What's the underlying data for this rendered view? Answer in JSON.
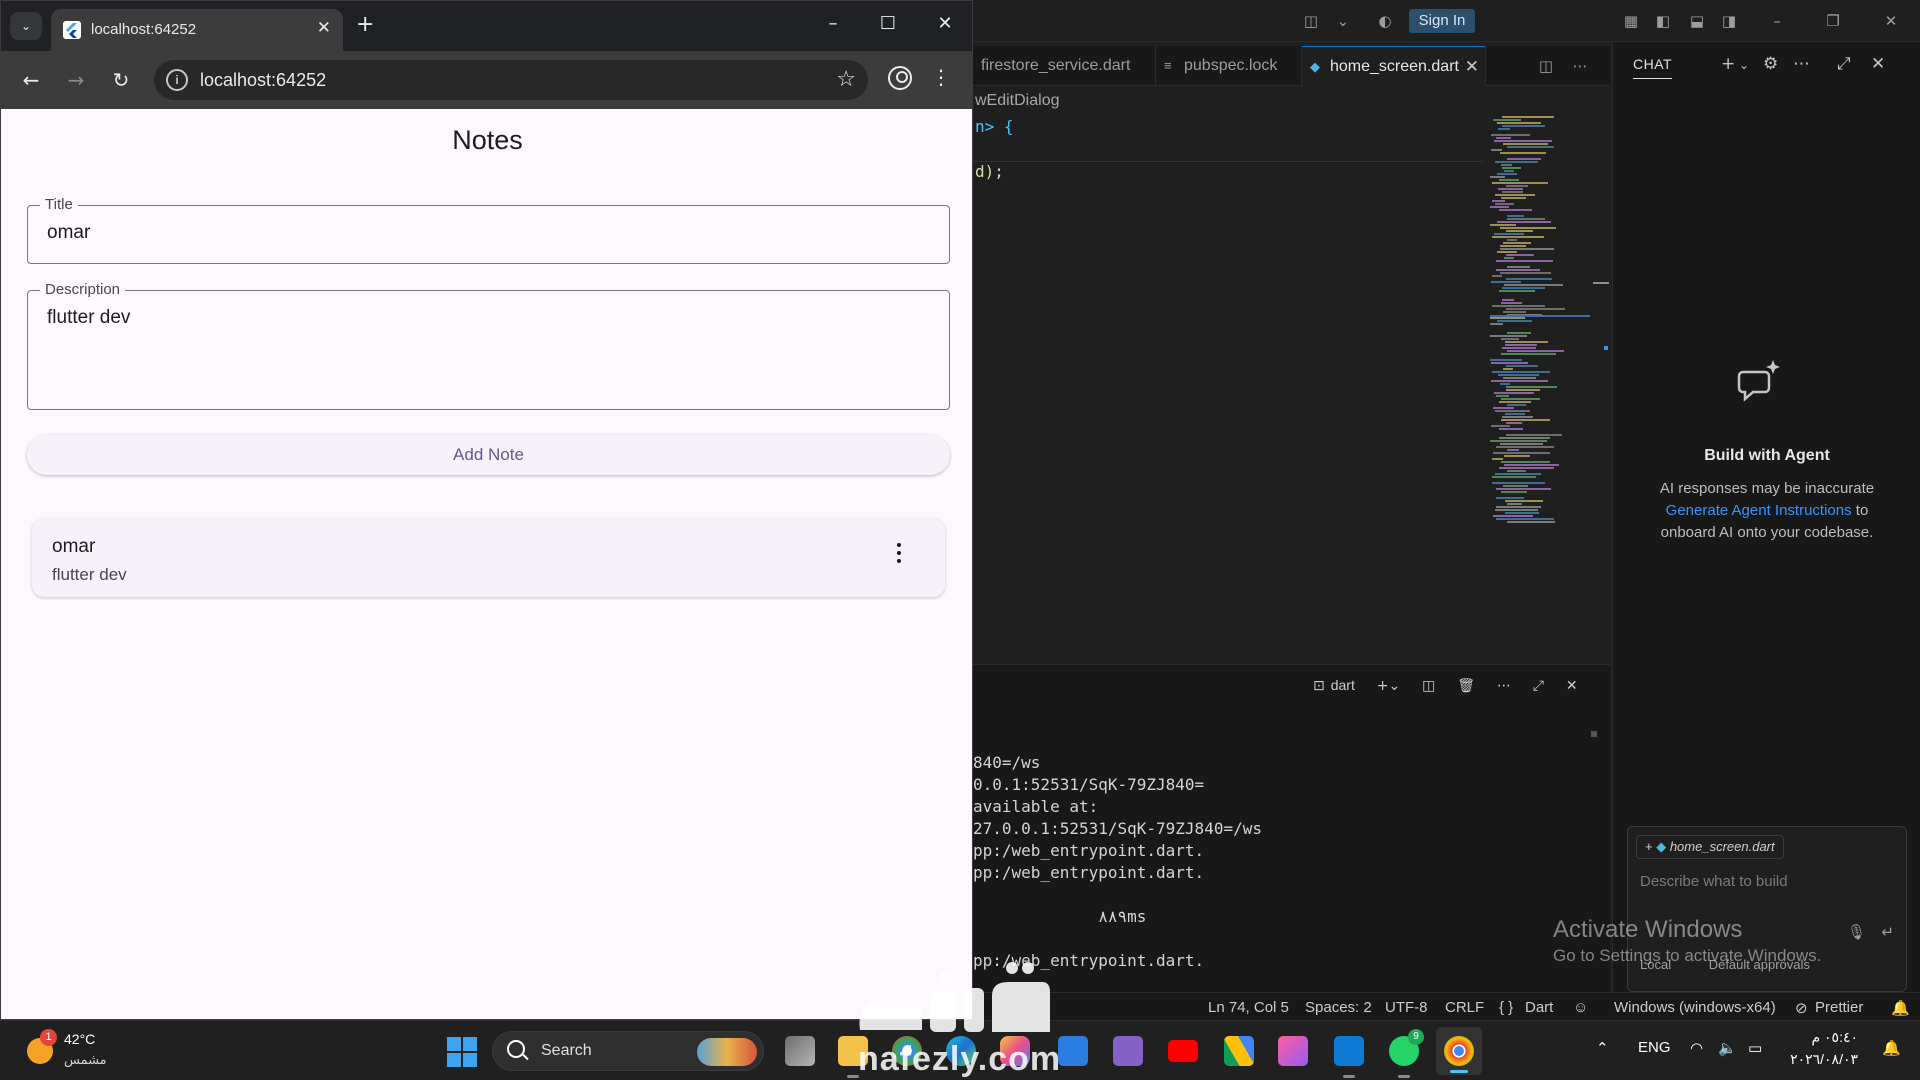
{
  "chrome": {
    "tab_title": "localhost:64252",
    "tab_close": "✕",
    "new_tab": "+",
    "url": "localhost:64252",
    "minimize": "–",
    "maximize": "☐",
    "close": "✕"
  },
  "app": {
    "title": "Notes",
    "title_field": {
      "label": "Title",
      "value": "omar"
    },
    "description_field": {
      "label": "Description",
      "value": "flutter dev"
    },
    "add_button": "Add Note",
    "notes": [
      {
        "title": "omar",
        "description": "flutter dev"
      }
    ]
  },
  "vscode": {
    "sign_in": "Sign In",
    "tabs": [
      {
        "label": "firestore_service.dart",
        "active": false
      },
      {
        "label": "pubspec.lock",
        "active": false
      },
      {
        "label": "home_screen.dart",
        "active": true
      }
    ],
    "breadcrumb": "wEditDialog",
    "code_lines": [
      "n> {",
      "d);"
    ],
    "chat": {
      "header": "CHAT",
      "agent_title": "Build with Agent",
      "agent_desc_1": "AI responses may be inaccurate",
      "agent_link": "Generate Agent Instructions",
      "agent_desc_2": " to onboard AI onto your codebase.",
      "context_file": "home_screen.dart",
      "input_placeholder": "Describe what to build",
      "mode_local": "Local",
      "mode_approvals": "Default approvals"
    },
    "terminal": {
      "profile": "dart",
      "lines": [
        "840=/ws",
        "0.0.1:52531/SqK-79ZJ840=",
        "available at:",
        "27.0.0.1:52531/SqK-79ZJ840=/ws",
        "pp:/web_entrypoint.dart.",
        "pp:/web_entrypoint.dart.",
        "",
        "             ٨٨٩ms",
        "",
        "pp:/web_entrypoint.dart."
      ]
    },
    "status": {
      "position": "Ln 74, Col 5",
      "spaces": "Spaces: 2",
      "encoding": "UTF-8",
      "eol": "CRLF",
      "language": "Dart",
      "device": "Windows (windows-x64)",
      "formatter": "Prettier"
    }
  },
  "activate_windows": {
    "title": "Activate Windows",
    "subtitle": "Go to Settings to activate Windows."
  },
  "taskbar": {
    "weather_badge": "1",
    "temperature": "42°C",
    "condition": "مشمس",
    "search_label": "Search",
    "language": "ENG",
    "time": "٠٥:٤٠ م",
    "date": "٢٠٢٦/٠٨/٠٣",
    "whatsapp_badge": "9"
  },
  "watermark": {
    "text": "nafezly.com"
  }
}
